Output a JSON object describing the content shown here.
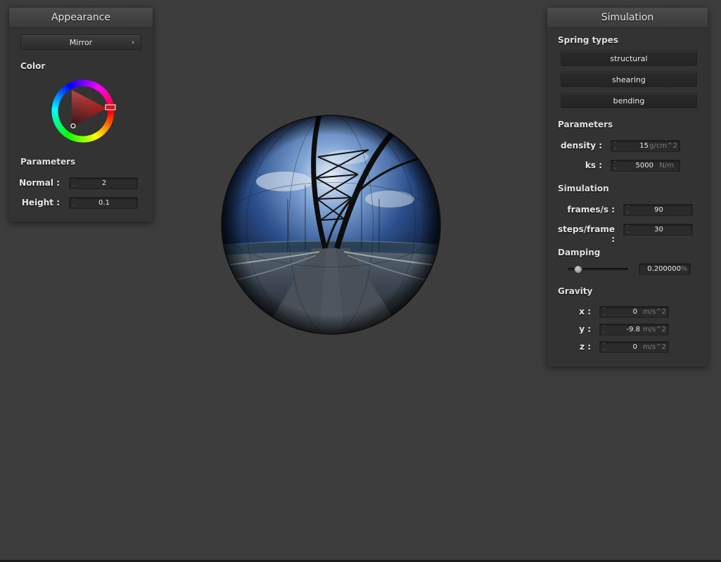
{
  "appearance": {
    "title": "Appearance",
    "shader_button": "Mirror",
    "color_label": "Color",
    "params_label": "Parameters",
    "normal_label": "Normal :",
    "normal_value": "2",
    "height_label": "Height :",
    "height_value": "0.1"
  },
  "simulation": {
    "title": "Simulation",
    "spring_types_label": "Spring types",
    "springs": [
      "structural",
      "shearing",
      "bending"
    ],
    "params_label": "Parameters",
    "density_label": "density :",
    "density_value": "15",
    "density_unit": "g/cm^2",
    "ks_label": "ks :",
    "ks_value": "5000",
    "ks_unit": "N/m",
    "sim_label": "Simulation",
    "fps_label": "frames/s :",
    "fps_value": "90",
    "steps_label": "steps/frame :",
    "steps_value": "30",
    "damping_label": "Damping",
    "damping_value": "0.200000",
    "damping_unit": "%",
    "damping_level": 0.2,
    "gravity_label": "Gravity",
    "gx_label": "x :",
    "gx_value": "0",
    "gy_label": "y :",
    "gy_value": "-9.8",
    "gz_label": "z :",
    "gz_value": "0",
    "gravity_unit": "m/s^2"
  },
  "colors": {
    "background": "#3d3d3d",
    "panel": "#333333",
    "selected_color": "#c81e1e"
  },
  "icons": {
    "spin": "spinner-arrows-icon",
    "chevron": "chevron-right-icon"
  }
}
